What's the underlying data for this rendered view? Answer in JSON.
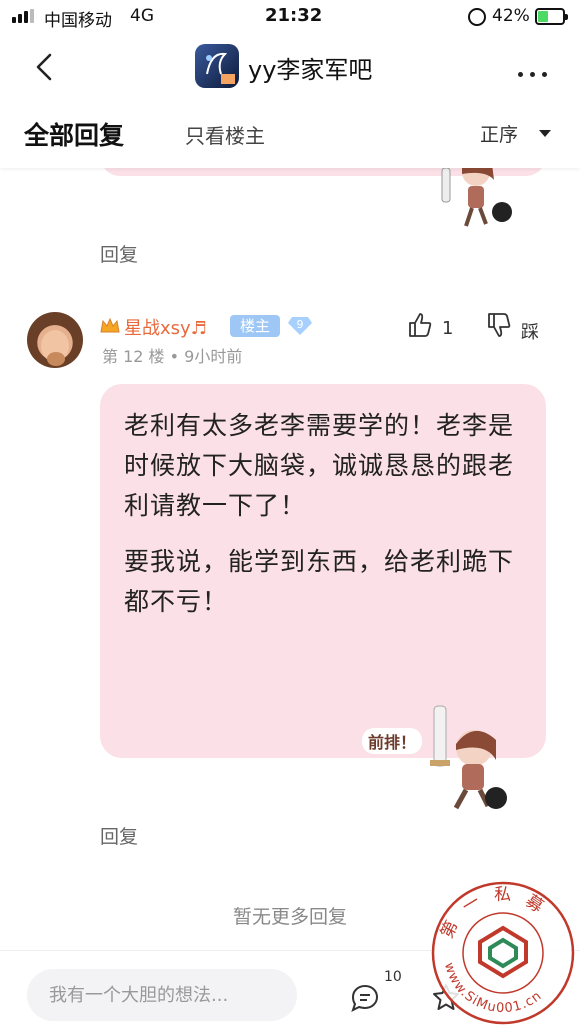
{
  "status_bar": {
    "carrier": "中国移动",
    "network": "4G",
    "time": "21:32",
    "battery_percent": "42%",
    "battery_level": 0.42
  },
  "nav": {
    "title": "yy李家军吧",
    "back_icon": "chevron-left-icon",
    "more_icon": "more-dots-icon"
  },
  "tabs": {
    "all_replies": "全部回复",
    "only_op": "只看楼主",
    "sort": "正序"
  },
  "previous_post": {
    "reply_label": "回复"
  },
  "post": {
    "username": "星战xsy♬",
    "op_badge": "楼主",
    "level": "9",
    "floor": "第 12 楼",
    "time": "9小时前",
    "like_count": "1",
    "dislike_label": "踩",
    "paragraphs": [
      "老利有太多老李需要学的！老李是时候放下大脑袋，诚诚恳恳的跟老利请教一下了！",
      "要我说，能学到东西，给老利跪下都不亏！"
    ],
    "sticker_text": "前排！",
    "reply_label": "回复"
  },
  "footer": {
    "no_more": "暂无更多回复"
  },
  "bottom_bar": {
    "input_placeholder": "我有一个大胆的想法...",
    "comment_count": "10"
  },
  "watermark": {
    "top_text": "第 一 私 募",
    "bottom_text": "www.SiMu001.cn"
  },
  "colors": {
    "bubble": "#fbe1e7",
    "username": "#e86a3c",
    "op_badge": "#9ec7f5",
    "watermark": "#c0392b"
  }
}
